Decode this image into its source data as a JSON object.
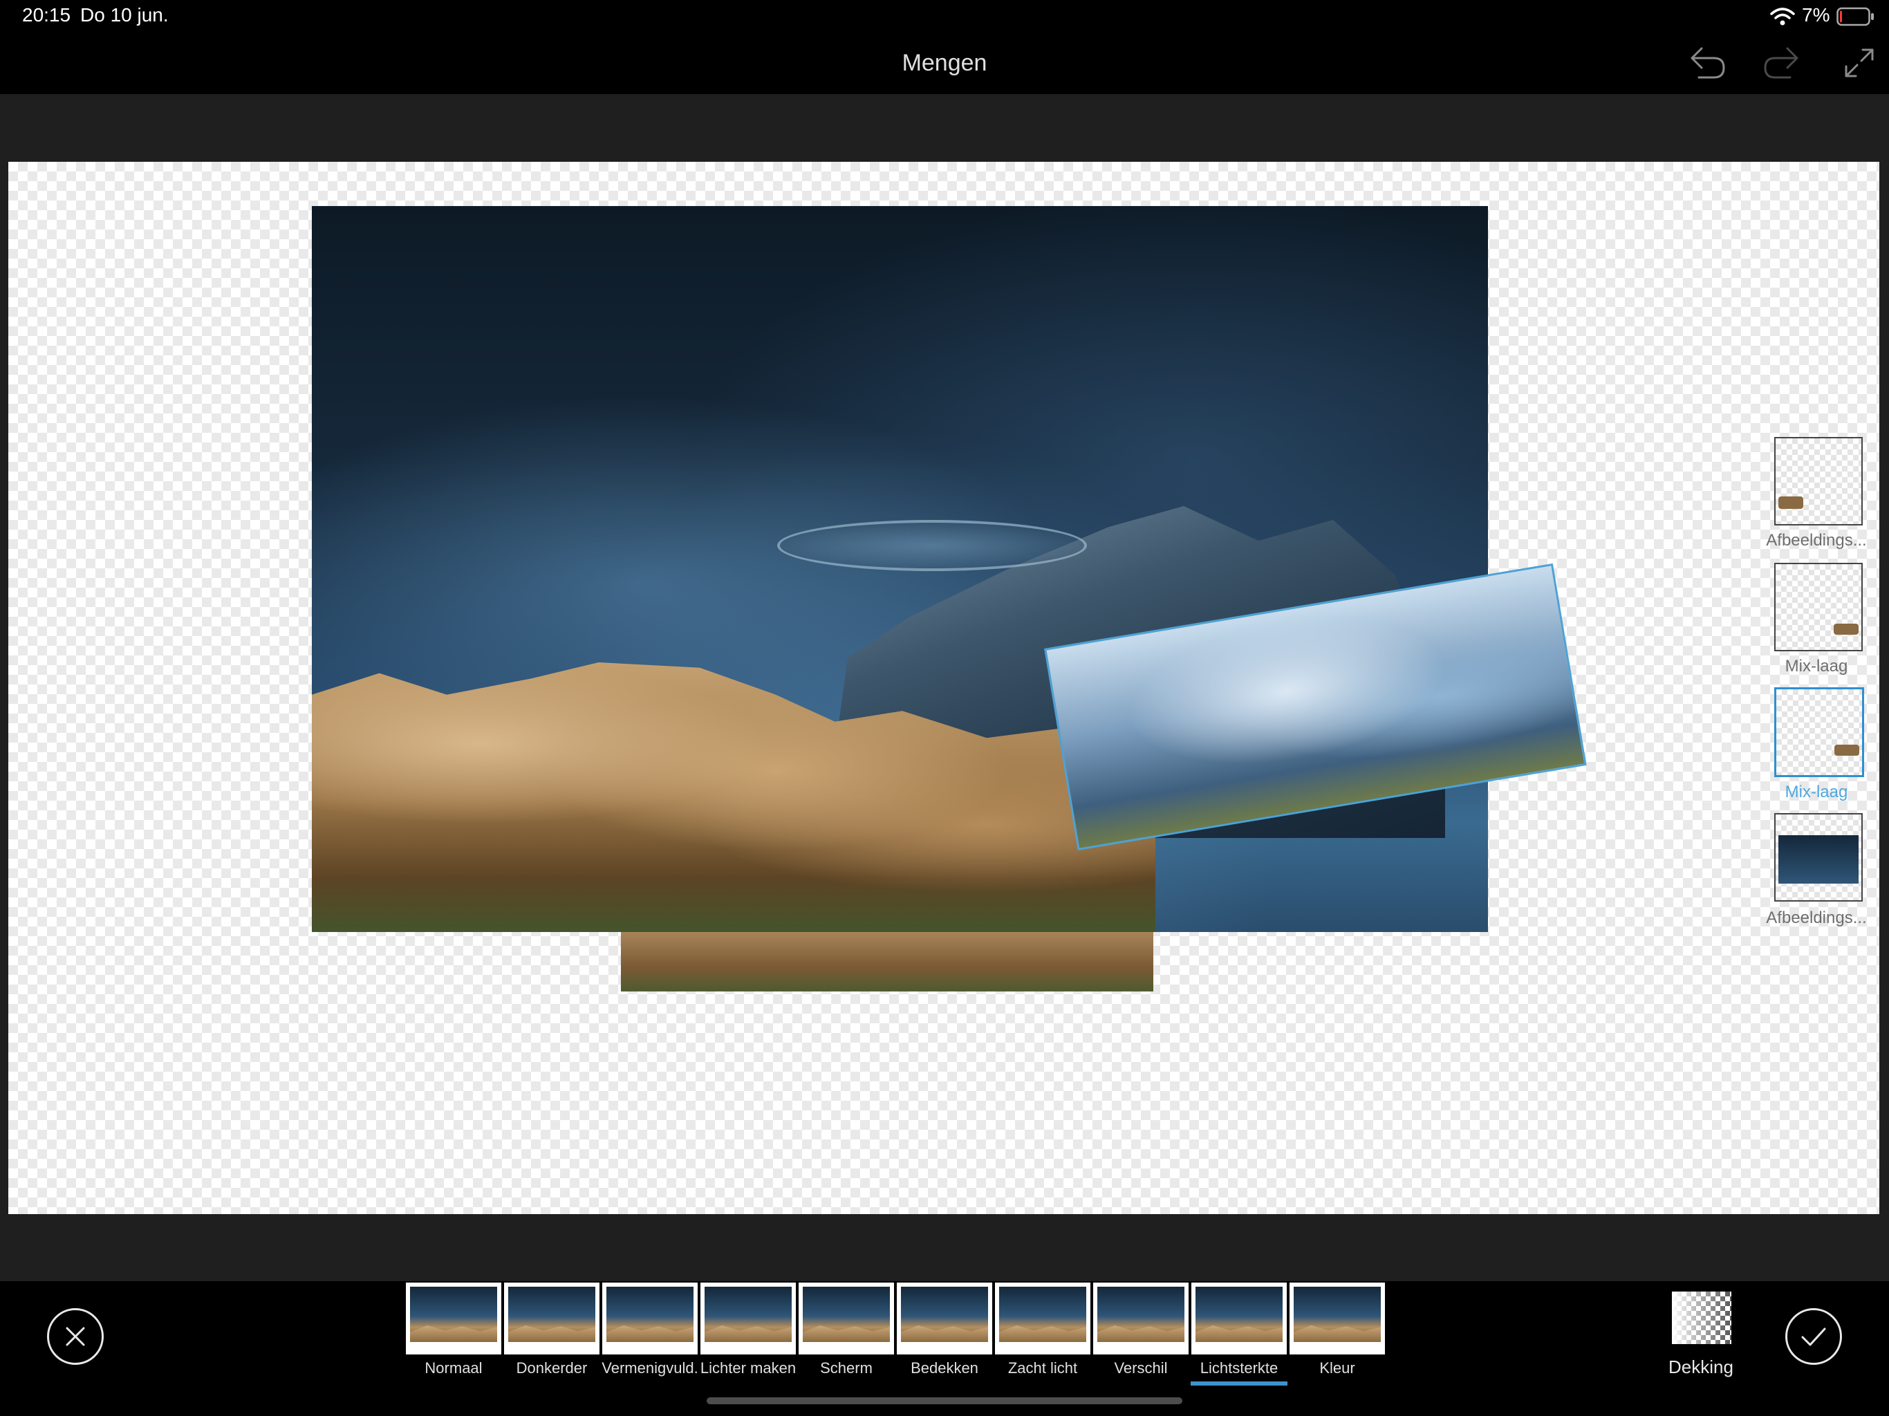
{
  "status_bar": {
    "time": "20:15",
    "date": "Do 10 jun.",
    "battery_percent": "7%",
    "battery_level": 0.07
  },
  "header": {
    "title": "Mengen",
    "undo_icon": "undo-icon",
    "redo_icon": "redo-icon",
    "fullscreen_icon": "expand-icon"
  },
  "layers": [
    {
      "label": "Afbeeldings...",
      "active": false
    },
    {
      "label": "Mix-laag",
      "active": false
    },
    {
      "label": "Mix-laag",
      "active": true
    },
    {
      "label": "Afbeeldings...",
      "active": false
    }
  ],
  "blend_modes": {
    "items": [
      {
        "label": "Normaal"
      },
      {
        "label": "Donkerder"
      },
      {
        "label": "Vermenigvuld."
      },
      {
        "label": "Lichter maken"
      },
      {
        "label": "Scherm"
      },
      {
        "label": "Bedekken"
      },
      {
        "label": "Zacht licht"
      },
      {
        "label": "Verschil"
      },
      {
        "label": "Lichtsterkte"
      },
      {
        "label": "Kleur"
      }
    ],
    "selected": "Lichtsterkte"
  },
  "opacity": {
    "label": "Dekking"
  },
  "colors": {
    "accent": "#3d93d0",
    "selection_border": "#4ea2d4",
    "background": "#1e1e1e",
    "bar": "#000000"
  }
}
